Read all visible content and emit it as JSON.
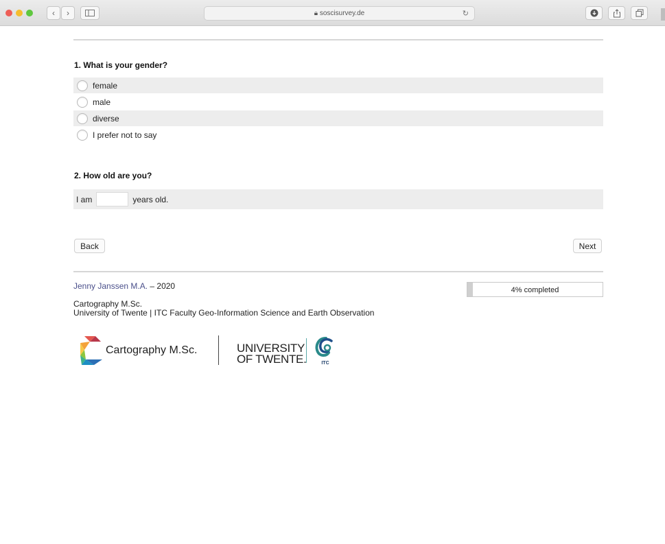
{
  "browser": {
    "url": "soscisurvey.de"
  },
  "survey": {
    "q1": {
      "title": "1. What is your gender?",
      "options": [
        "female",
        "male",
        "diverse",
        "I prefer not to say"
      ]
    },
    "q2": {
      "title": "2. How old are you?",
      "prefix": "I am",
      "suffix": "years old.",
      "value": ""
    },
    "nav": {
      "back": "Back",
      "next": "Next"
    },
    "footer": {
      "author": "Jenny Janssen M.A.",
      "year": " – 2020",
      "line1": "Cartography M.Sc.",
      "line2": "University of Twente | ITC Faculty Geo-Information Science and Earth Observation",
      "progress_text": "4% completed",
      "progress_value": 0.04
    },
    "logos": {
      "cartography": "Cartography M.Sc.",
      "ut_line1": "UNIVERSITY",
      "ut_line2": "OF TWENTE.",
      "itc": "ITC"
    }
  },
  "colors": {
    "traffic_red": "#ee5e57",
    "traffic_yellow": "#f5bd2f",
    "traffic_green": "#5fc73f",
    "author_link": "#4a4f8a",
    "itc_teal": "#2a8a8a",
    "itc_blue": "#1f4f8a"
  }
}
